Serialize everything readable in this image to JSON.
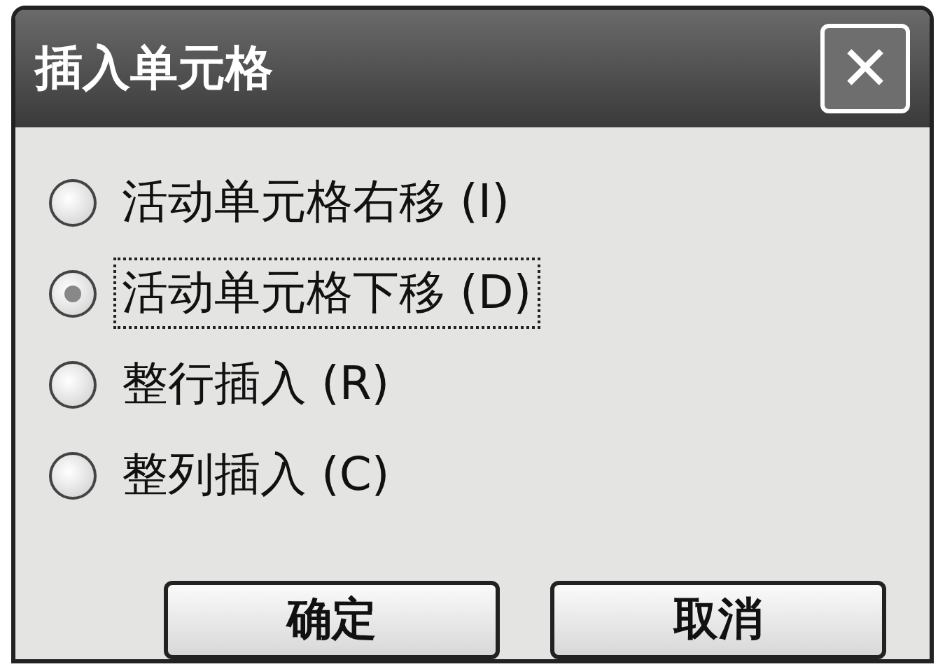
{
  "window": {
    "title": "插入单元格",
    "close_glyph": "✕"
  },
  "options": [
    {
      "label": "活动单元格右移 (I)",
      "selected": false,
      "focused": false
    },
    {
      "label": "活动单元格下移 (D)",
      "selected": true,
      "focused": true
    },
    {
      "label": "整行插入 (R)",
      "selected": false,
      "focused": false
    },
    {
      "label": "整列插入 (C)",
      "selected": false,
      "focused": false
    }
  ],
  "buttons": [
    {
      "label": "确定"
    },
    {
      "label": "取消"
    }
  ]
}
